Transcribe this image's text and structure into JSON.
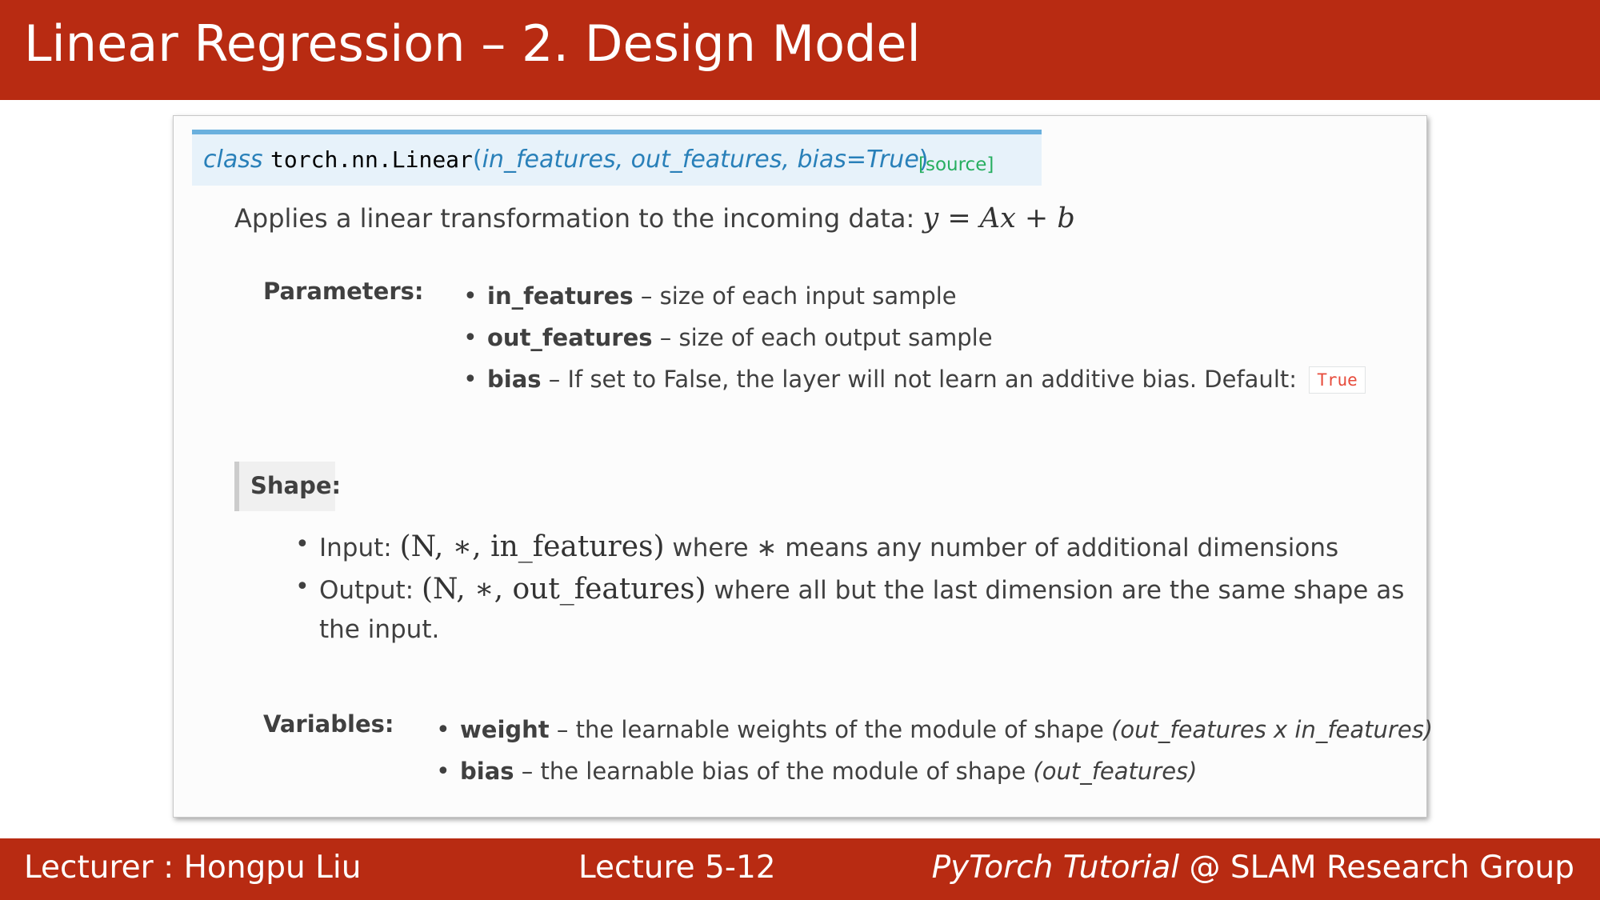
{
  "slide": {
    "title": "Linear Regression – 2. Design Model",
    "footer": {
      "lecturer": "Lecturer : Hongpu Liu",
      "lecture": "Lecture 5-12",
      "course_italic": "PyTorch Tutorial",
      "course_rest": " @ SLAM Research Group"
    }
  },
  "doc": {
    "signature": {
      "keyword": "class",
      "name": "torch.nn.Linear",
      "open_paren": "(",
      "args": "in_features, out_features, bias=True",
      "close_paren": ")",
      "source_link": "[source]"
    },
    "description": "Applies a linear transformation to the incoming data: ",
    "formula": "y = Ax + b",
    "parameters": {
      "label": "Parameters:",
      "items": [
        {
          "name": "in_features",
          "text": " – size of each input sample"
        },
        {
          "name": "out_features",
          "text": " – size of each output sample"
        },
        {
          "name": "bias",
          "text": " – If set to False, the layer will not learn an additive bias. Default: ",
          "code": "True"
        }
      ]
    },
    "shape": {
      "label": "Shape:",
      "items": [
        {
          "prefix": "Input: ",
          "math": "(N, ∗, in_features)",
          "text": " where ∗ means any number of additional dimensions"
        },
        {
          "prefix": "Output: ",
          "math": "(N, ∗, out_features)",
          "text": " where all but the last dimension are the same shape as",
          "continuation": "the input."
        }
      ]
    },
    "variables": {
      "label": "Variables:",
      "items": [
        {
          "name": "weight",
          "text": " – the learnable weights of the module of shape ",
          "shape": "(out_features x in_features)"
        },
        {
          "name": "bias",
          "text": " – the learnable bias of the module of shape ",
          "shape": "(out_features)"
        }
      ]
    }
  },
  "colors": {
    "header_bg": "#b82b12",
    "signature_bg": "#e7f2fa",
    "signature_border": "#6ab0de",
    "keyword": "#2980b9",
    "source_link": "#27ae60",
    "code_true": "#e74c3c"
  }
}
